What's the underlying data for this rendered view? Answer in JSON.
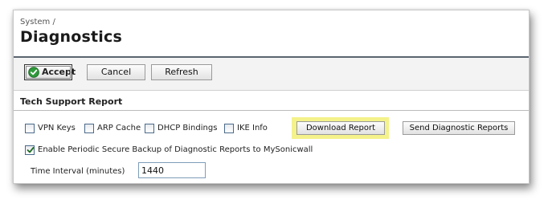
{
  "header": {
    "breadcrumb": "System /",
    "title": "Diagnostics"
  },
  "toolbar": {
    "accept_label": "Accept",
    "cancel_label": "Cancel",
    "refresh_label": "Refresh"
  },
  "tech_support": {
    "section_title": "Tech Support Report",
    "options": [
      {
        "label": "VPN Keys",
        "checked": false
      },
      {
        "label": "ARP Cache",
        "checked": false
      },
      {
        "label": "DHCP Bindings",
        "checked": false
      },
      {
        "label": "IKE Info",
        "checked": false
      }
    ],
    "download_label": "Download Report",
    "send_label": "Send Diagnostic Reports",
    "periodic_backup": {
      "label": "Enable Periodic Secure Backup of Diagnostic Reports to MySonicwall",
      "checked": true
    },
    "time_interval": {
      "label": "Time Interval (minutes)",
      "value": "1440"
    }
  },
  "colors": {
    "highlight": "#f4f28a",
    "accept_icon": "#2e9a3a",
    "checkmark": "#1f6b25",
    "title_rule": "#5a6470"
  },
  "icons": {
    "accept": "check-circle-icon",
    "periodic_backup": "checkmark-icon"
  }
}
